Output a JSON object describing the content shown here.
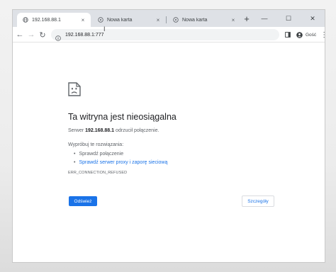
{
  "tabs": [
    {
      "title": "192.168.88.1",
      "active": true
    },
    {
      "title": "Nowa karta",
      "active": false
    },
    {
      "title": "Nowa karta",
      "active": false
    }
  ],
  "tab_close_glyph": "×",
  "new_tab_glyph": "+",
  "window_controls": {
    "minimize": "—",
    "maximize": "☐",
    "close": "✕"
  },
  "toolbar": {
    "back_glyph": "←",
    "forward_glyph": "→",
    "reload_glyph": "↻",
    "url": "192.168.88.1:777",
    "guest_label": "Gość",
    "menu_glyph": "⋮"
  },
  "error": {
    "title": "Ta witryna jest nieosiągalna",
    "server_prefix": "Serwer",
    "server_host": "192.168.88.1",
    "server_suffix": "odrzucił połączenie.",
    "try_label": "Wypróbuj te rozwiązania:",
    "suggestions": [
      "Sprawdź połączenie",
      "Sprawdź serwer proxy i zaporę sieciową"
    ],
    "code": "ERR_CONNECTION_REFUSED",
    "reload_button": "Odśwież",
    "details_button": "Szczegóły"
  },
  "colors": {
    "accent": "#1a73e8",
    "tabstrip": "#dee1e6",
    "text": "#202124",
    "muted": "#5f6368"
  }
}
